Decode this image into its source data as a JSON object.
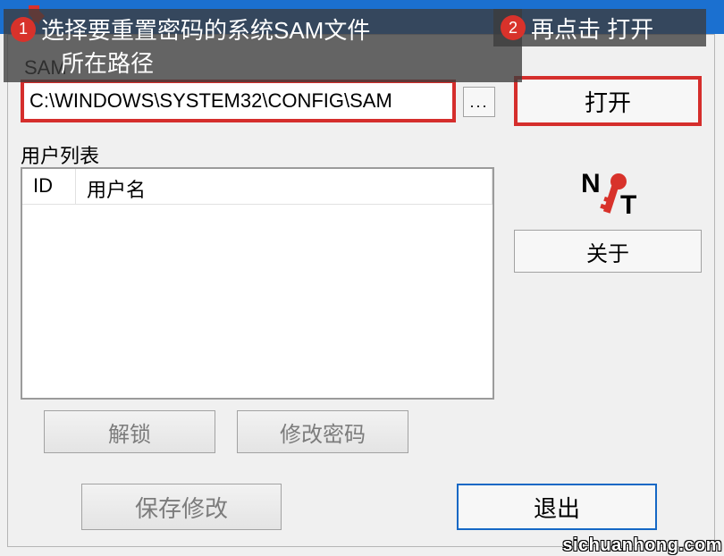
{
  "path": {
    "label": "SAM",
    "value": "C:\\WINDOWS\\SYSTEM32\\CONFIG\\SAM",
    "browse": "..."
  },
  "buttons": {
    "open": "打开",
    "about": "关于",
    "unlock": "解锁",
    "change_password": "修改密码",
    "save": "保存修改",
    "exit": "退出"
  },
  "userlist": {
    "label": "用户列表",
    "columns": {
      "id": "ID",
      "username": "用户名"
    }
  },
  "annotations": {
    "step1": {
      "num": "1",
      "text_line1": "选择要重置密码的系统SAM文件",
      "text_line2": "所在路径"
    },
    "step2": {
      "num": "2",
      "text": "再点击 打开"
    }
  },
  "logo": {
    "text": "NT"
  },
  "watermark": "sichuanhong.com"
}
